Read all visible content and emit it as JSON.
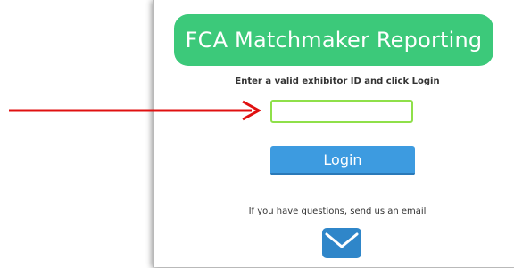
{
  "header": {
    "title": "FCA Matchmaker Reporting",
    "color": "#3cc97a"
  },
  "form": {
    "instructions": "Enter a valid exhibitor ID and click Login",
    "exhibitor_id_value": "",
    "exhibitor_id_border_color": "#8fe04a",
    "login_label": "Login",
    "login_color": "#3d9be0"
  },
  "footer": {
    "question_text": "If you have questions, send us an email",
    "email_icon": "envelope-icon"
  },
  "annotation": {
    "arrow_icon": "red-arrow-icon",
    "arrow_color": "#e01010"
  }
}
